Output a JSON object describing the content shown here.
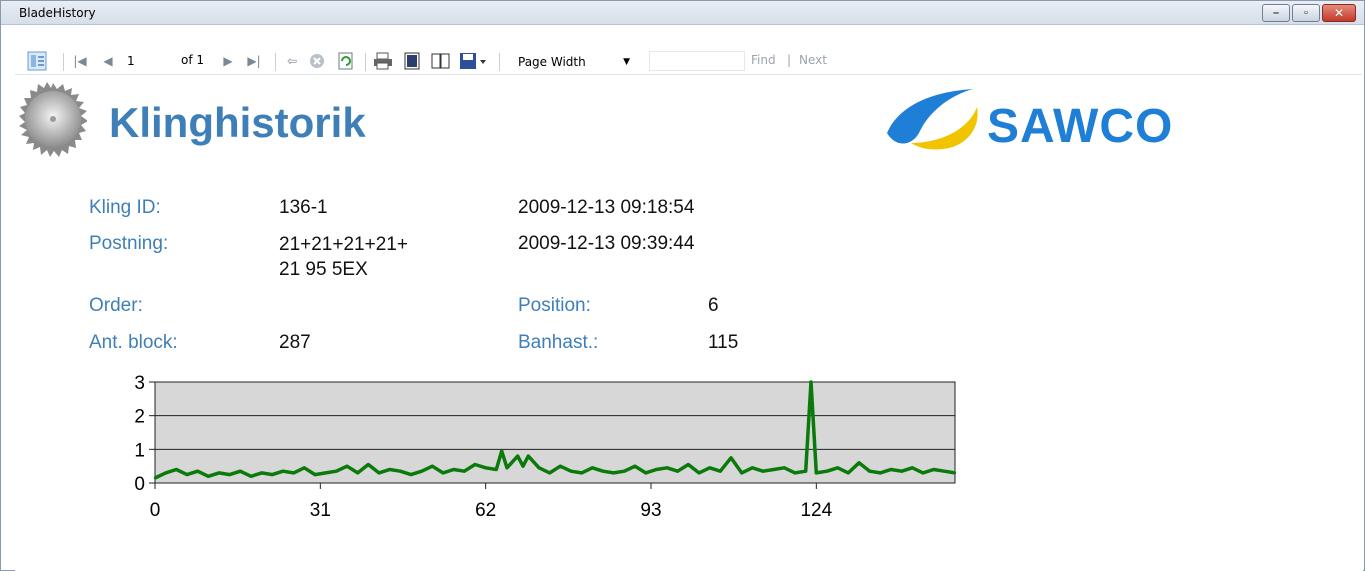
{
  "window": {
    "title": "BladeHistory"
  },
  "toolbar": {
    "page_current": "1",
    "page_of": "of 1",
    "zoom": "Page Width",
    "find_label": "Find",
    "separator": "|",
    "next_label": "Next"
  },
  "report": {
    "title": "Klinghistorik",
    "brand": "SAWCO",
    "fields": {
      "kling_id_label": "Kling ID:",
      "kling_id_value": "136-1",
      "date1": "2009-12-13 09:18:54",
      "postning_label": "Postning:",
      "postning_value_line1": "21+21+21+21+",
      "postning_value_line2": "21 95 5EX",
      "date2": "2009-12-13 09:39:44",
      "order_label": "Order:",
      "position_label": "Position:",
      "position_value": "6",
      "antblock_label": "Ant. block:",
      "antblock_value": "287",
      "banhast_label": "Banhast.:",
      "banhast_value": "115"
    }
  },
  "colors": {
    "label_blue": "#3f7fb8",
    "brand_blue": "#1f7fd6",
    "brand_yellow": "#f2c400",
    "series_green": "#0a7a0a",
    "plot_bg": "#d7d7d7"
  },
  "chart_data": {
    "type": "line",
    "title": "",
    "xlabel": "",
    "ylabel": "",
    "xlim": [
      0,
      150
    ],
    "ylim": [
      0,
      3
    ],
    "xticks": [
      0,
      31,
      62,
      93,
      124
    ],
    "yticks": [
      0,
      1,
      2,
      3
    ],
    "grid": "horizontal",
    "series": [
      {
        "x": [
          0,
          2,
          4,
          6,
          8,
          10,
          12,
          14,
          16,
          18,
          20,
          22,
          24,
          26,
          28,
          30,
          32,
          34,
          36,
          38,
          40,
          42,
          44,
          46,
          48,
          50,
          52,
          54,
          56,
          58,
          60,
          62,
          64,
          65,
          66,
          68,
          69,
          70,
          72,
          74,
          76,
          78,
          80,
          82,
          84,
          86,
          88,
          90,
          92,
          94,
          96,
          98,
          100,
          102,
          104,
          106,
          108,
          110,
          112,
          114,
          116,
          118,
          120,
          122,
          123,
          124,
          126,
          128,
          130,
          132,
          134,
          136,
          138,
          140,
          142,
          144,
          146,
          148,
          150
        ],
        "y": [
          0.15,
          0.3,
          0.4,
          0.25,
          0.35,
          0.2,
          0.3,
          0.25,
          0.35,
          0.2,
          0.3,
          0.25,
          0.35,
          0.3,
          0.45,
          0.25,
          0.3,
          0.35,
          0.5,
          0.3,
          0.55,
          0.3,
          0.4,
          0.35,
          0.25,
          0.35,
          0.5,
          0.3,
          0.4,
          0.35,
          0.55,
          0.45,
          0.4,
          0.95,
          0.45,
          0.8,
          0.5,
          0.8,
          0.45,
          0.3,
          0.5,
          0.35,
          0.3,
          0.45,
          0.35,
          0.3,
          0.35,
          0.5,
          0.3,
          0.4,
          0.45,
          0.35,
          0.55,
          0.3,
          0.45,
          0.35,
          0.75,
          0.3,
          0.45,
          0.35,
          0.4,
          0.45,
          0.3,
          0.35,
          3.0,
          0.3,
          0.35,
          0.45,
          0.3,
          0.6,
          0.35,
          0.3,
          0.4,
          0.35,
          0.45,
          0.3,
          0.4,
          0.35,
          0.3
        ]
      }
    ]
  }
}
